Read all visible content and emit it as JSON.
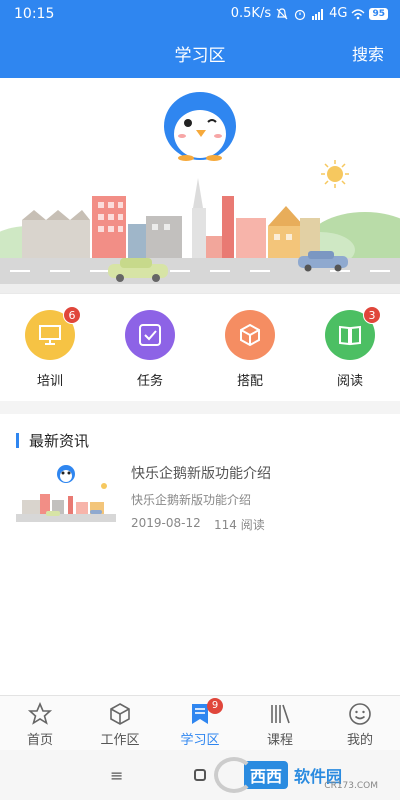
{
  "status_bar": {
    "time": "10:15",
    "speed": "0.5K/s",
    "network": "4G",
    "battery": "95"
  },
  "header": {
    "title": "学习区",
    "search_label": "搜索"
  },
  "categories": [
    {
      "label": "培训",
      "icon": "easel-icon",
      "color": "#f6c344",
      "badge": "6"
    },
    {
      "label": "任务",
      "icon": "checkbox-icon",
      "color": "#8d63e6",
      "badge": ""
    },
    {
      "label": "搭配",
      "icon": "cube-icon",
      "color": "#f58d62",
      "badge": ""
    },
    {
      "label": "阅读",
      "icon": "book-icon",
      "color": "#4cbf63",
      "badge": "3"
    }
  ],
  "news": {
    "heading": "最新资讯",
    "items": [
      {
        "title": "快乐企鹅新版功能介绍",
        "subtitle": "快乐企鹅新版功能介绍",
        "date": "2019-08-12",
        "reads": "114 阅读"
      }
    ]
  },
  "bottom_nav": [
    {
      "label": "首页",
      "icon": "star-icon",
      "active": false,
      "badge": ""
    },
    {
      "label": "工作区",
      "icon": "cube-outline-icon",
      "active": false,
      "badge": ""
    },
    {
      "label": "学习区",
      "icon": "bookmark-list-icon",
      "active": true,
      "badge": "9"
    },
    {
      "label": "课程",
      "icon": "books-icon",
      "active": false,
      "badge": ""
    },
    {
      "label": "我的",
      "icon": "smiley-icon",
      "active": false,
      "badge": ""
    }
  ],
  "system_bar": {
    "menu_glyph": "≡"
  },
  "watermark": {
    "text1": "西西",
    "text2": "软件园",
    "url": "CR173.COM"
  },
  "colors": {
    "primary": "#2f86f0",
    "badge": "#e0463b"
  }
}
